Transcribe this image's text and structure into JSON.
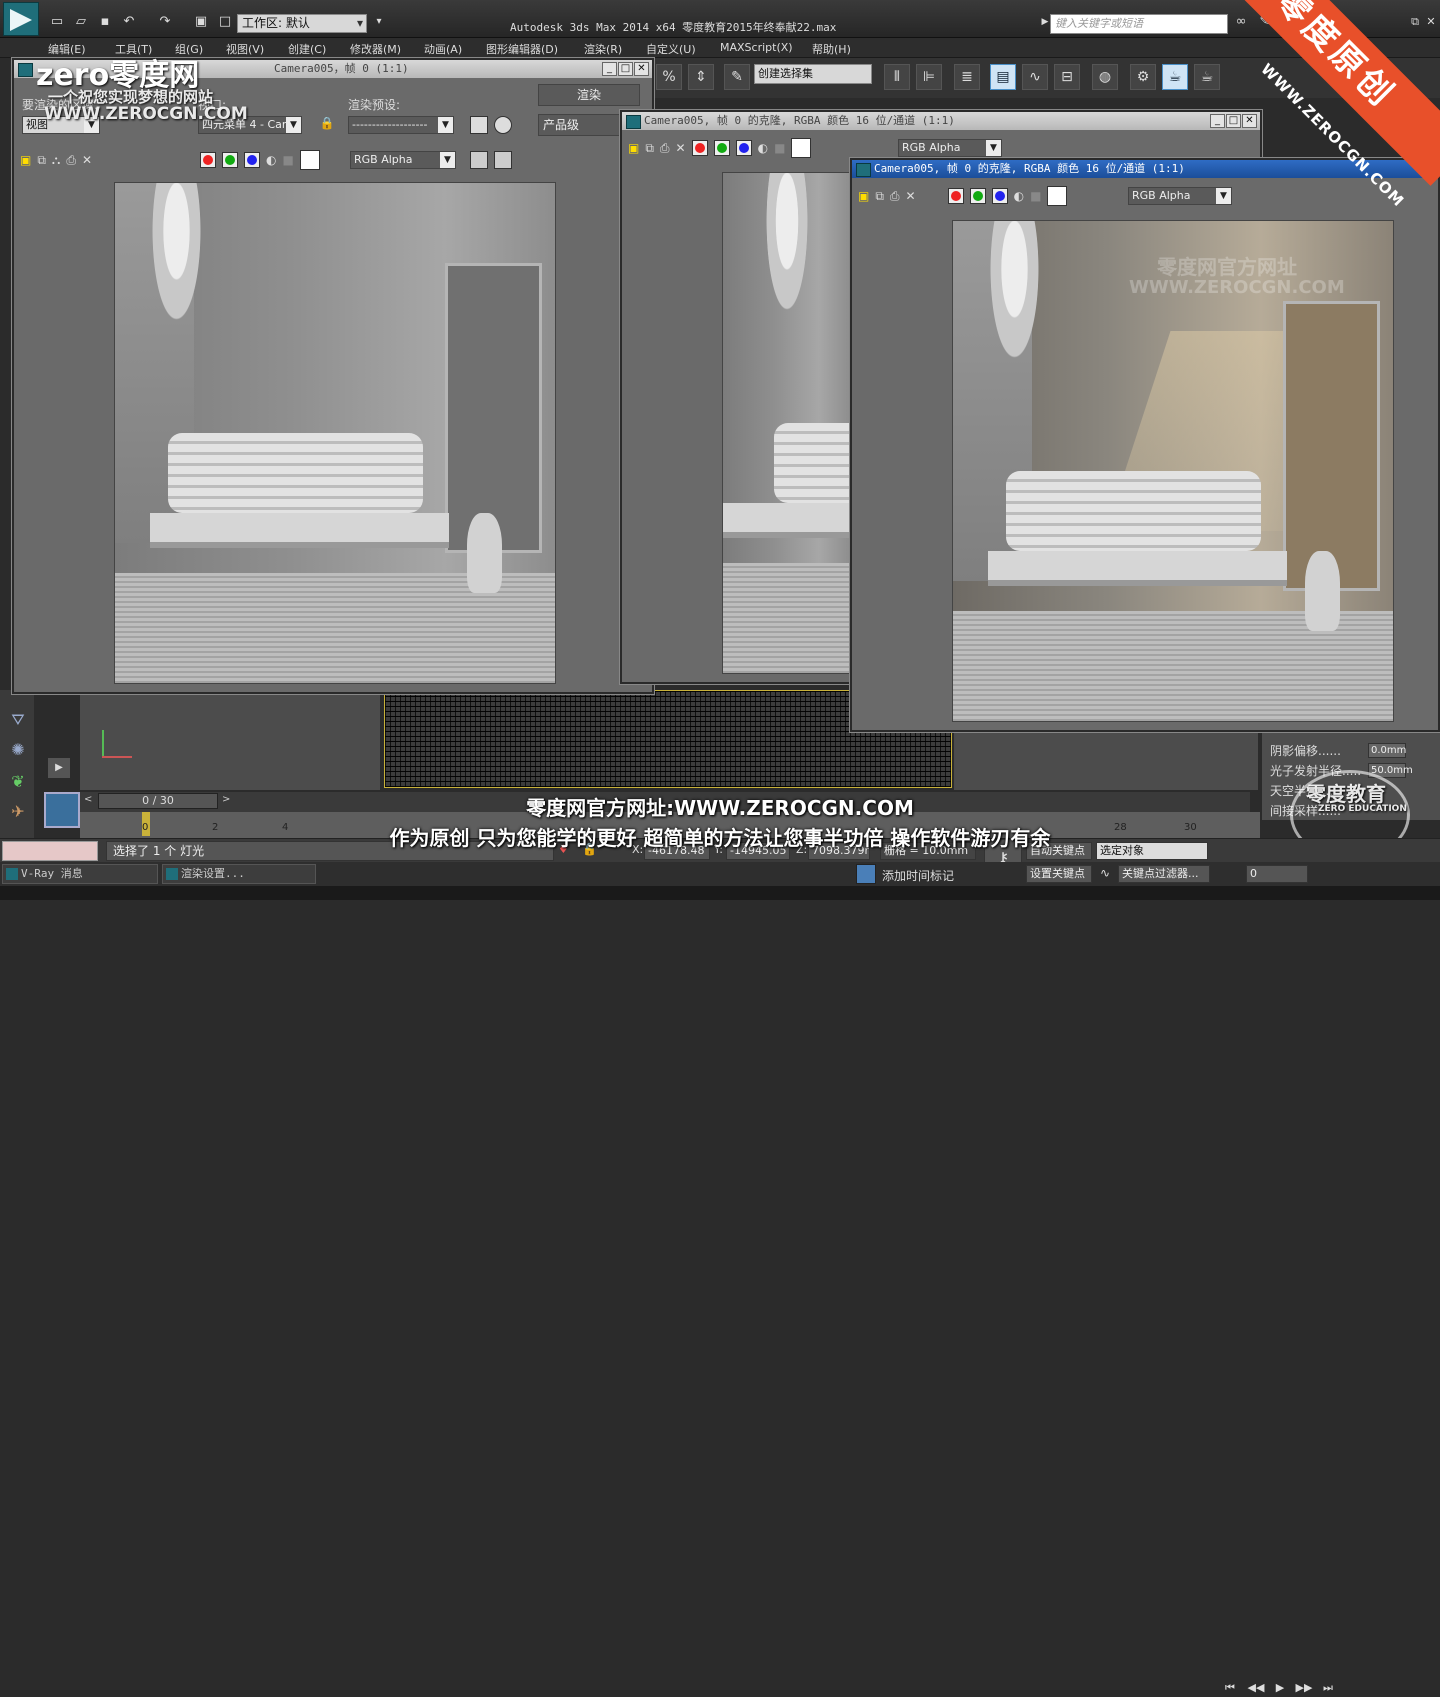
{
  "app": {
    "title": "Autodesk 3ds Max  2014 x64    零度教育2015年终奉献22.max",
    "workspace": "工作区: 默认",
    "search_placeholder": "键入关键字或短语"
  },
  "menu": [
    "编辑(E)",
    "工具(T)",
    "组(G)",
    "视图(V)",
    "创建(C)",
    "修改器(M)",
    "动画(A)",
    "图形编辑器(D)",
    "渲染(R)",
    "自定义(U)",
    "MAXScript(X)",
    "帮助(H)"
  ],
  "toolbar": {
    "selection_set": "创建选择集",
    "buttons": [
      "snap-percent",
      "snap-spinner",
      "abc-edit",
      "mirror",
      "align",
      "layers",
      "scene-explorer",
      "curve-editor",
      "schematic",
      "material-editor",
      "render-setup",
      "rendered-frame",
      "render"
    ]
  },
  "render_dialog": {
    "title": "Camera005，帧 0 (1:1)",
    "title_visible": "位/通道 (1:1)",
    "area_label": "要渲染的区域:",
    "area_value": "视图",
    "viewport_label": "视口:",
    "viewport_value": "四元菜单 4 - Cam",
    "preset_label": "渲染预设:",
    "preset_value": "-------------------",
    "render_button": "渲染",
    "product_level": "产品级",
    "channel": "RGB Alpha"
  },
  "clone1": {
    "title": "Camera005, 帧 0 的克隆, RGBA 颜色 16 位/通道 (1:1)",
    "channel": "RGB Alpha"
  },
  "clone2": {
    "title": "Camera005, 帧 0 的克隆, RGBA 颜色 16 位/通道 (1:1)",
    "channel": "RGB Alpha"
  },
  "watermark": {
    "logo": "zero零度网",
    "slogan": "一个祝您实现梦想的网站",
    "url": "WWW.ZEROCGN.COM",
    "ribbon": "零度原创",
    "ribbon_url": "WWW.ZEROCGN.COM",
    "img_wm_1": "零度网官方网址",
    "img_wm_2": "WWW.ZEROCGN.COM",
    "edu": "零度教育",
    "edu_en": "ZERO EDUCATION"
  },
  "subtitles": {
    "line1": "零度网官方网址:WWW.ZEROCGN.COM",
    "line2": "作为原创 只为您能学的更好 超简单的方法让您事半功倍 操作软件游刃有余"
  },
  "right_panel": {
    "rows": [
      {
        "label": "阴影偏移......",
        "value": "0.0mm"
      },
      {
        "label": "光子发射半径.....",
        "value": "50.0mm"
      },
      {
        "label": "天空半径......",
        "value": ""
      },
      {
        "label": "间接采样......",
        "value": ""
      }
    ]
  },
  "timeline": {
    "frame": "0 / 30",
    "ticks": [
      "0",
      "2",
      "4",
      "28",
      "30"
    ]
  },
  "status": {
    "message": "选择了 1 个 灯光",
    "x_label": "X:",
    "x": "-46178.48",
    "y_label": "Y:",
    "y": "-14945.05",
    "z_label": "Z:",
    "z": "7098.379m",
    "grid": "栅格 = 10.0mm",
    "auto_key": "自动关键点",
    "selected": "选定对象",
    "set_key": "设置关键点",
    "key_filter": "关键点过滤器...",
    "add_time_tag": "添加时间标记",
    "frame_value": "0"
  },
  "taskbar": {
    "vray": "V-Ray 消息",
    "render_setup": "渲染设置..."
  },
  "colors": {
    "accent": "#e8502a",
    "active_caption": "#2f6cc4",
    "highlight": "#cfe4f5"
  }
}
